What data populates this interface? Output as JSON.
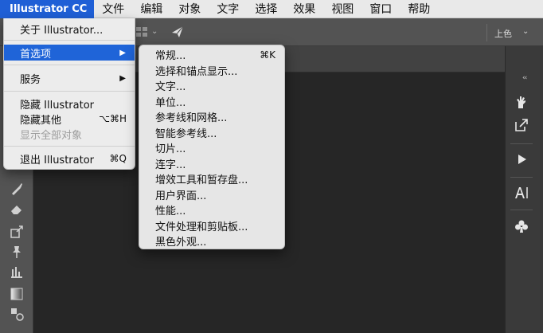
{
  "menubar": {
    "app_name": "Illustrator CC",
    "items": [
      "文件",
      "编辑",
      "对象",
      "文字",
      "选择",
      "效果",
      "视图",
      "窗口",
      "帮助"
    ]
  },
  "controlbar": {
    "color_label": "上色",
    "color_chevron": "⌄",
    "dropdown_chevron": "⌄"
  },
  "app_menu": {
    "about": "关于 Illustrator...",
    "preferences": "首选项",
    "preferences_arrow": "▶",
    "services": "服务",
    "services_arrow": "▶",
    "hide_app": "隐藏 Illustrator",
    "hide_others": "隐藏其他",
    "hide_others_shortcut": "⌥⌘H",
    "show_all": "显示全部对象",
    "quit": "退出 Illustrator",
    "quit_shortcut": "⌘Q"
  },
  "preferences_menu": {
    "items": [
      {
        "label": "常规...",
        "shortcut": "⌘K"
      },
      {
        "label": "选择和锚点显示...",
        "shortcut": ""
      },
      {
        "label": "文字...",
        "shortcut": ""
      },
      {
        "label": "单位...",
        "shortcut": ""
      },
      {
        "label": "参考线和网格...",
        "shortcut": ""
      },
      {
        "label": "智能参考线...",
        "shortcut": ""
      },
      {
        "label": "切片...",
        "shortcut": ""
      },
      {
        "label": "连字...",
        "shortcut": ""
      },
      {
        "label": "增效工具和暂存盘...",
        "shortcut": ""
      },
      {
        "label": "用户界面...",
        "shortcut": ""
      },
      {
        "label": "性能...",
        "shortcut": ""
      },
      {
        "label": "文件处理和剪贴板...",
        "shortcut": ""
      },
      {
        "label": "黑色外观...",
        "shortcut": ""
      }
    ]
  },
  "right_panel": {
    "collapse_glyph": "‹‹",
    "icons": [
      "hand-puppet-icon",
      "export-icon",
      "play-icon",
      "type-panel-icon",
      "club-symbol-icon"
    ]
  },
  "colors": {
    "menubar_bg": "#e9e9e9",
    "selection": "#1f64d8",
    "app_bg": "#535353",
    "canvas_bg": "#262626"
  }
}
